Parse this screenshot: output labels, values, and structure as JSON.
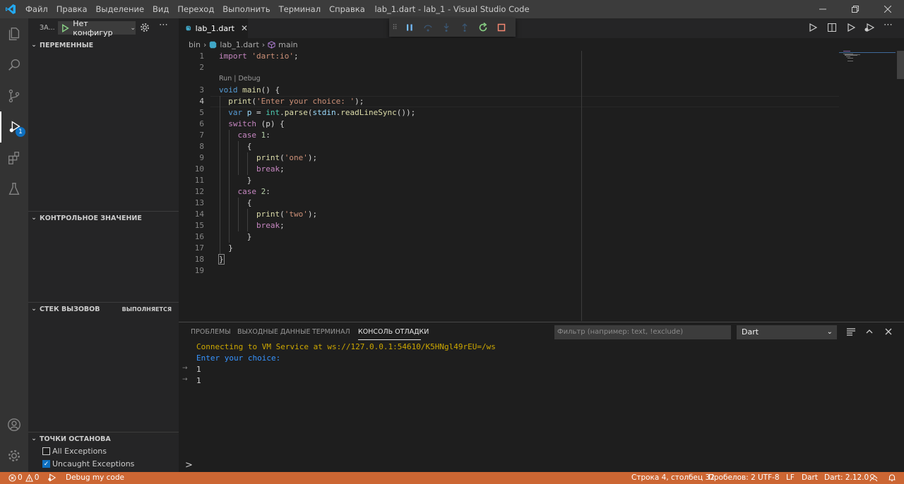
{
  "window": {
    "title": "lab_1.dart - lab_1 - Visual Studio Code",
    "menu": [
      "Файл",
      "Правка",
      "Выделение",
      "Вид",
      "Переход",
      "Выполнить",
      "Терминал",
      "Справка"
    ]
  },
  "sidebar": {
    "title": "ЗА...",
    "config_select": "Нет конфигур",
    "debug_badge": "1",
    "sections": {
      "variables": "ПЕРЕМЕННЫЕ",
      "watch": "КОНТРОЛЬНОЕ ЗНАЧЕНИЕ",
      "callstack": "СТЕК ВЫЗОВОВ",
      "callstack_status": "ВЫПОЛНЯЕТСЯ",
      "breakpoints": "ТОЧКИ ОСТАНОВА"
    },
    "breakpoints": [
      {
        "label": "All Exceptions",
        "checked": false
      },
      {
        "label": "Uncaught Exceptions",
        "checked": true
      }
    ]
  },
  "editor": {
    "tab_label": "lab_1.dart",
    "breadcrumb": [
      "bin",
      "lab_1.dart",
      "main"
    ],
    "codelens": "Run | Debug",
    "current_line": 4,
    "line_numbers": [
      "1",
      "2",
      "3",
      "4",
      "5",
      "6",
      "7",
      "8",
      "9",
      "10",
      "11",
      "12",
      "13",
      "14",
      "15",
      "16",
      "17",
      "18",
      "19"
    ],
    "code": {
      "l1_kw": "import",
      "l1_str": "'dart:io'",
      "l1_end": ";",
      "l3_kw": "void",
      "l3_fn": "main",
      "l3_rest": "() {",
      "l4_fn": "print",
      "l4_str": "'Enter your choice: '",
      "l4_end": ");",
      "l5_kw": "var",
      "l5_v": "p",
      "l5_eq": " = ",
      "l5_ty": "int",
      "l5_dot": ".",
      "l5_fn": "parse",
      "l5_a": "(",
      "l5_v2": "stdin",
      "l5_b": ".",
      "l5_fn2": "readLineSync",
      "l5_end": "());",
      "l6_kw": "switch",
      "l6_rest": " (p) {",
      "l7_kw": "case",
      "l7_num": "1",
      "l7_end": ":",
      "l8": "{",
      "l9_fn": "print",
      "l9_str": "'one'",
      "l9_end": ");",
      "l10_kw": "break",
      "l10_end": ";",
      "l11": "}",
      "l12_kw": "case",
      "l12_num": "2",
      "l12_end": ":",
      "l13": "{",
      "l14_fn": "print",
      "l14_str": "'two'",
      "l14_end": ");",
      "l15_kw": "break",
      "l15_end": ";",
      "l16": "}",
      "l17": "}",
      "l18": "}"
    }
  },
  "panel": {
    "tabs": [
      "ПРОБЛЕМЫ",
      "ВЫХОДНЫЕ ДАННЫЕ",
      "ТЕРМИНАЛ",
      "КОНСОЛЬ ОТЛАДКИ"
    ],
    "active_tab": "КОНСОЛЬ ОТЛАДКИ",
    "filter_placeholder": "Фильтр (например: text, !exclude)",
    "session_select": "Dart",
    "console_lines": [
      "Connecting to VM Service at ws://127.0.0.1:54610/K5HNgl49rEU=/ws",
      "Enter your choice:",
      "1",
      "1"
    ],
    "prompt": ">"
  },
  "statusbar": {
    "errors": "0",
    "warnings": "0",
    "debug_label": "Debug my code",
    "position": "Строка 4, столбец 32",
    "spaces": "Пробелов: 2",
    "encoding": "UTF-8",
    "eol": "LF",
    "language": "Dart",
    "sdk": "Dart: 2.12.0"
  },
  "colors": {
    "statusbar": "#cc6633",
    "accent": "#0e70c0",
    "console_connect": "#cca700",
    "console_text": "#3794ff"
  }
}
